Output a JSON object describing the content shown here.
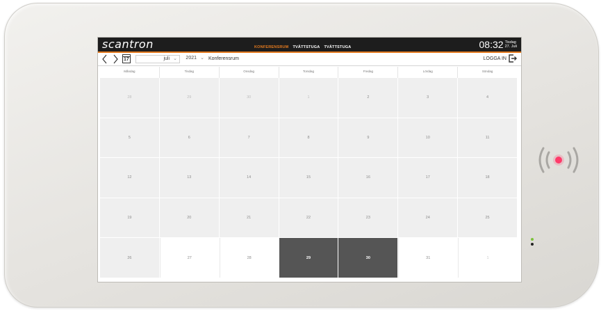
{
  "brand": {
    "logo": "scantron"
  },
  "tabs": [
    {
      "label": "KONFERENSRUM",
      "active": true
    },
    {
      "label": "TVÄTTSTUGA",
      "active": false
    },
    {
      "label": "TVÄTTSTUGA",
      "active": false
    }
  ],
  "clock": {
    "time": "08:32",
    "weekday": "Tisdag",
    "date": "27. Juli"
  },
  "toolbar": {
    "month": "juli",
    "year": "2021",
    "room": "Konferensrum",
    "login_label": "LOGGA IN",
    "calendar_icon_day": "17"
  },
  "weekdays": [
    "Måndag",
    "Tisdag",
    "Onsdag",
    "Torsdag",
    "Fredag",
    "Lördag",
    "Söndag"
  ],
  "calendar": {
    "days": [
      {
        "d": "28",
        "s": "other"
      },
      {
        "d": "29",
        "s": "other"
      },
      {
        "d": "30",
        "s": "other"
      },
      {
        "d": "1",
        "s": "other"
      },
      {
        "d": "2",
        "s": ""
      },
      {
        "d": "3",
        "s": ""
      },
      {
        "d": "4",
        "s": ""
      },
      {
        "d": "5",
        "s": ""
      },
      {
        "d": "6",
        "s": ""
      },
      {
        "d": "7",
        "s": ""
      },
      {
        "d": "8",
        "s": ""
      },
      {
        "d": "9",
        "s": ""
      },
      {
        "d": "10",
        "s": ""
      },
      {
        "d": "11",
        "s": ""
      },
      {
        "d": "12",
        "s": ""
      },
      {
        "d": "13",
        "s": ""
      },
      {
        "d": "14",
        "s": ""
      },
      {
        "d": "15",
        "s": ""
      },
      {
        "d": "16",
        "s": ""
      },
      {
        "d": "17",
        "s": ""
      },
      {
        "d": "18",
        "s": ""
      },
      {
        "d": "19",
        "s": ""
      },
      {
        "d": "20",
        "s": ""
      },
      {
        "d": "21",
        "s": ""
      },
      {
        "d": "22",
        "s": ""
      },
      {
        "d": "23",
        "s": ""
      },
      {
        "d": "24",
        "s": ""
      },
      {
        "d": "25",
        "s": ""
      },
      {
        "d": "26",
        "s": ""
      },
      {
        "d": "27",
        "s": "white"
      },
      {
        "d": "28",
        "s": "white"
      },
      {
        "d": "29",
        "s": "dark"
      },
      {
        "d": "30",
        "s": "dark"
      },
      {
        "d": "31",
        "s": "white"
      },
      {
        "d": "1",
        "s": "white other"
      }
    ]
  },
  "colors": {
    "accent": "#e37a1f",
    "topbar": "#1d1d1d",
    "booked": "#555555",
    "rfid_led": "#ff3b6b",
    "status_led_green": "#7cc23a"
  },
  "icons": [
    "chevron-left-icon",
    "chevron-right-icon",
    "calendar-icon",
    "chevron-down-icon",
    "logout-icon",
    "rfid-icon"
  ]
}
